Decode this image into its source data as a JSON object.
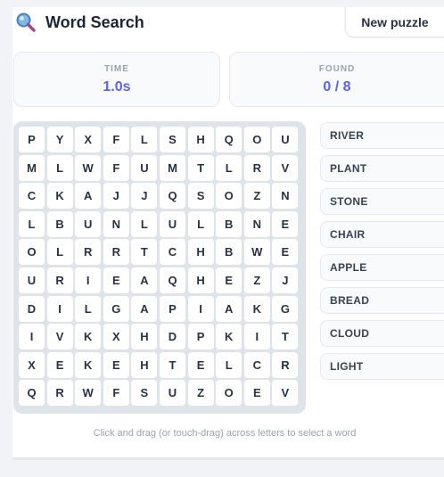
{
  "header": {
    "title": "Word Search",
    "new_puzzle_label": "New puzzle"
  },
  "stats": {
    "time_label": "TIME",
    "time_value": "1.0s",
    "found_label": "FOUND",
    "found_value": "0 / 8"
  },
  "grid": [
    [
      "P",
      "Y",
      "X",
      "F",
      "L",
      "S",
      "H",
      "Q",
      "O",
      "U"
    ],
    [
      "M",
      "L",
      "W",
      "F",
      "U",
      "M",
      "T",
      "L",
      "R",
      "V"
    ],
    [
      "C",
      "K",
      "A",
      "J",
      "J",
      "Q",
      "S",
      "O",
      "Z",
      "N"
    ],
    [
      "L",
      "B",
      "U",
      "N",
      "L",
      "U",
      "L",
      "B",
      "N",
      "E"
    ],
    [
      "O",
      "L",
      "R",
      "R",
      "T",
      "C",
      "H",
      "B",
      "W",
      "E"
    ],
    [
      "U",
      "R",
      "I",
      "E",
      "A",
      "Q",
      "H",
      "E",
      "Z",
      "J"
    ],
    [
      "D",
      "I",
      "L",
      "G",
      "A",
      "P",
      "I",
      "A",
      "K",
      "G"
    ],
    [
      "I",
      "V",
      "K",
      "X",
      "H",
      "D",
      "P",
      "K",
      "I",
      "T"
    ],
    [
      "X",
      "E",
      "K",
      "E",
      "H",
      "T",
      "E",
      "L",
      "C",
      "R"
    ],
    [
      "Q",
      "R",
      "W",
      "F",
      "S",
      "U",
      "Z",
      "O",
      "E",
      "V"
    ]
  ],
  "words": [
    "RIVER",
    "PLANT",
    "STONE",
    "CHAIR",
    "APPLE",
    "BREAD",
    "CLOUD",
    "LIGHT"
  ],
  "hint": "Click and drag (or touch-drag) across letters to select a word",
  "icons": {
    "logo": "magnifier-icon"
  },
  "colors": {
    "accent": "#5b63e6",
    "grid_bg": "#dfe3ea"
  }
}
